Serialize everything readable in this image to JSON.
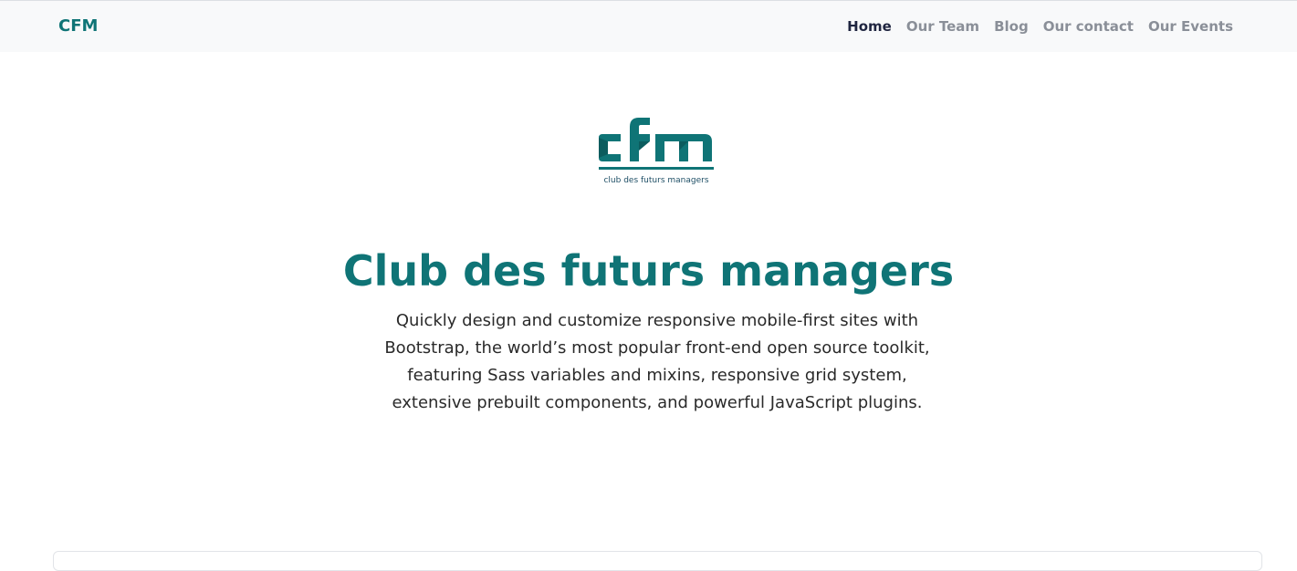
{
  "navbar": {
    "brand": "CFM",
    "links": [
      {
        "label": "Home",
        "active": true
      },
      {
        "label": "Our Team",
        "active": false
      },
      {
        "label": "Blog",
        "active": false
      },
      {
        "label": "Our contact",
        "active": false
      },
      {
        "label": "Our Events",
        "active": false
      }
    ]
  },
  "hero": {
    "logo": {
      "mark": "cfm",
      "tagline": "club des futurs managers"
    },
    "title": "Club des futurs managers",
    "lead": "Quickly design and customize responsive mobile-first sites with Bootstrap, the world’s most popular front-end open source toolkit, featuring Sass variables and mixins, responsive grid system, extensive prebuilt components, and powerful JavaScript plugins."
  },
  "colors": {
    "brand_teal": "#0f7476",
    "nav_bg": "#f8f9fa",
    "nav_active": "#1f2540",
    "nav_inactive": "#8a8f98"
  }
}
